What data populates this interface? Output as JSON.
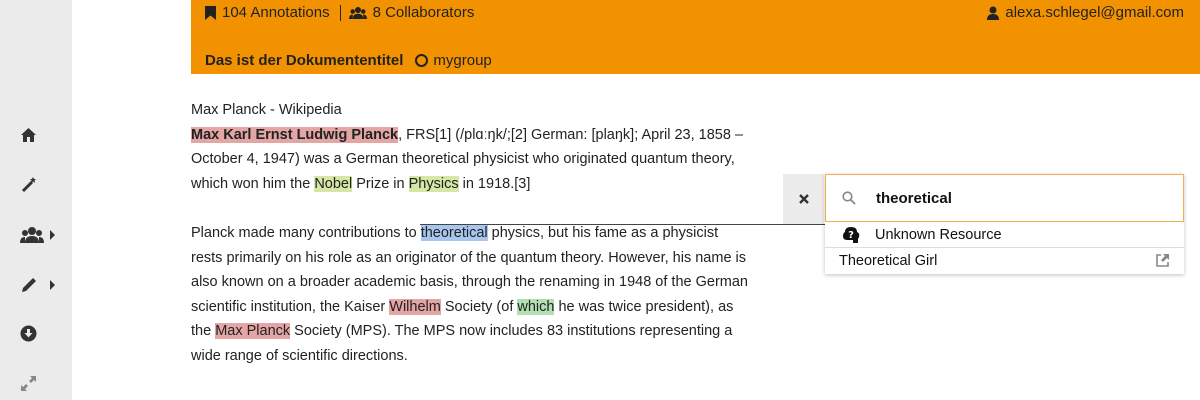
{
  "header": {
    "annotations": "104 Annotations",
    "collaborators": "8 Collaborators",
    "email": "alexa.schlegel@gmail.com",
    "doc_title": "Das ist der Dokumententitel",
    "group": "mygroup",
    "color": "#f39200"
  },
  "sidebar": {
    "items": [
      "home-icon",
      "magic-wand-icon",
      "group-icon",
      "pencil-icon",
      "download-icon",
      "expand-icon"
    ]
  },
  "document": {
    "title": "Max Planck - Wikipedia",
    "p1": {
      "name": "Max Karl Ernst Ludwig Planck",
      "t1": ", FRS[1] (/plɑːŋk/;[2] German: [plaŋk]; April 23, 1858 – October 4, 1947) was a German theoretical physicist who originated quantum theory, which won him the ",
      "nobel": "Nobel",
      "t2": " Prize in ",
      "physics": "Physics",
      "t3": " in 1918.[3]"
    },
    "p2": {
      "t1": "Planck made many contributions to ",
      "theoretical": "theoretical",
      "t2": " physics, but his fame as a physicist rests primarily on his role as an originator of the quantum theory. However, his name is also known on a broader academic basis, through the renaming in 1948 of the German scientific institution, the Kaiser ",
      "wilhelm": "Wilhelm",
      "t3": " Society (of ",
      "which": "which",
      "t4": " he was twice president), as the ",
      "maxplanck": "Max Planck",
      "t5": " Society (MPS). The MPS now includes 83 institutions representing a wide range of scientific directions."
    }
  },
  "search": {
    "value": "theoretical",
    "results": [
      "Unknown Resource",
      "Theoretical Girl"
    ]
  }
}
